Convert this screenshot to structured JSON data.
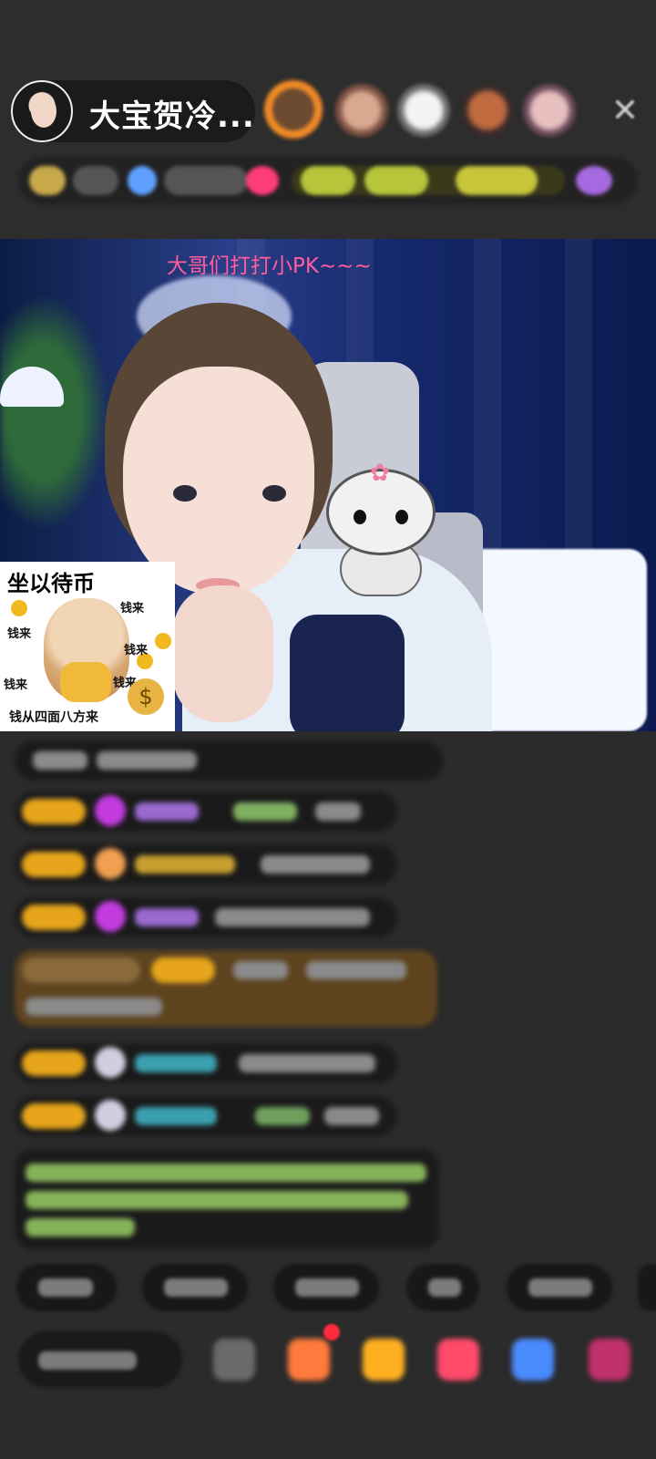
{
  "header": {
    "host_name": "大宝贺冷...",
    "close_symbol": "✕"
  },
  "stream": {
    "overlay_title": "大哥们打打小PK~~~"
  },
  "sticker": {
    "title": "坐以待币",
    "money_labels": [
      "钱来",
      "钱来",
      "钱来",
      "钱来",
      "钱来"
    ],
    "footer": "钱从四面八方来"
  },
  "colors": {
    "overlay_title": "#ff5d9e",
    "badge": "#e6a51a",
    "background": "#2b2b2b"
  }
}
